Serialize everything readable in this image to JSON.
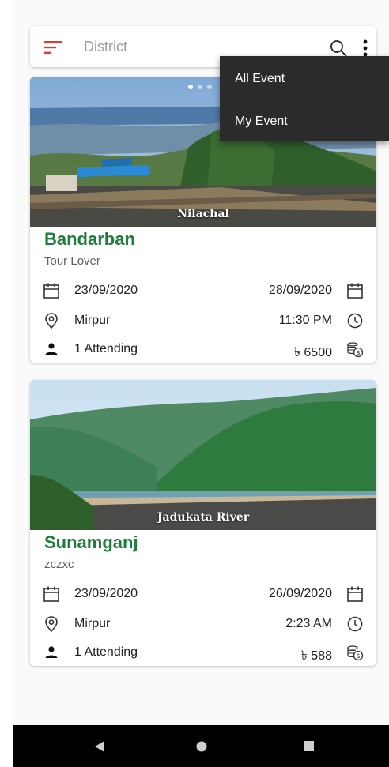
{
  "search": {
    "placeholder": "District"
  },
  "menu": {
    "items": [
      {
        "label": "All Event"
      },
      {
        "label": "My Event"
      }
    ]
  },
  "events": [
    {
      "image_caption": "Nilachal",
      "title": "Bandarban",
      "subtitle": "Tour Lover",
      "start_date": "23/09/2020",
      "end_date": "28/09/2020",
      "location": "Mirpur",
      "time": "11:30 PM",
      "attending": "1 Attending",
      "price": "৳ 6500",
      "carousel_pages": 3,
      "carousel_active": 1
    },
    {
      "image_caption": "Jadukata River",
      "title": "Sunamganj",
      "subtitle": "zczxc",
      "start_date": "23/09/2020",
      "end_date": "26/09/2020",
      "location": "Mirpur",
      "time": "2:23 AM",
      "attending": "1 Attending",
      "price": "৳ 588"
    }
  ],
  "colors": {
    "accent": "#e53935",
    "title_green": "#1e7d3c",
    "menu_bg": "#2b2b2b",
    "nav_bg": "#000000"
  },
  "icons": {
    "filter": "filter-icon",
    "search": "search-icon",
    "more": "more-vert-icon",
    "calendar": "calendar-icon",
    "location": "location-pin-icon",
    "clock": "clock-icon",
    "person": "person-icon",
    "money": "money-icon"
  }
}
